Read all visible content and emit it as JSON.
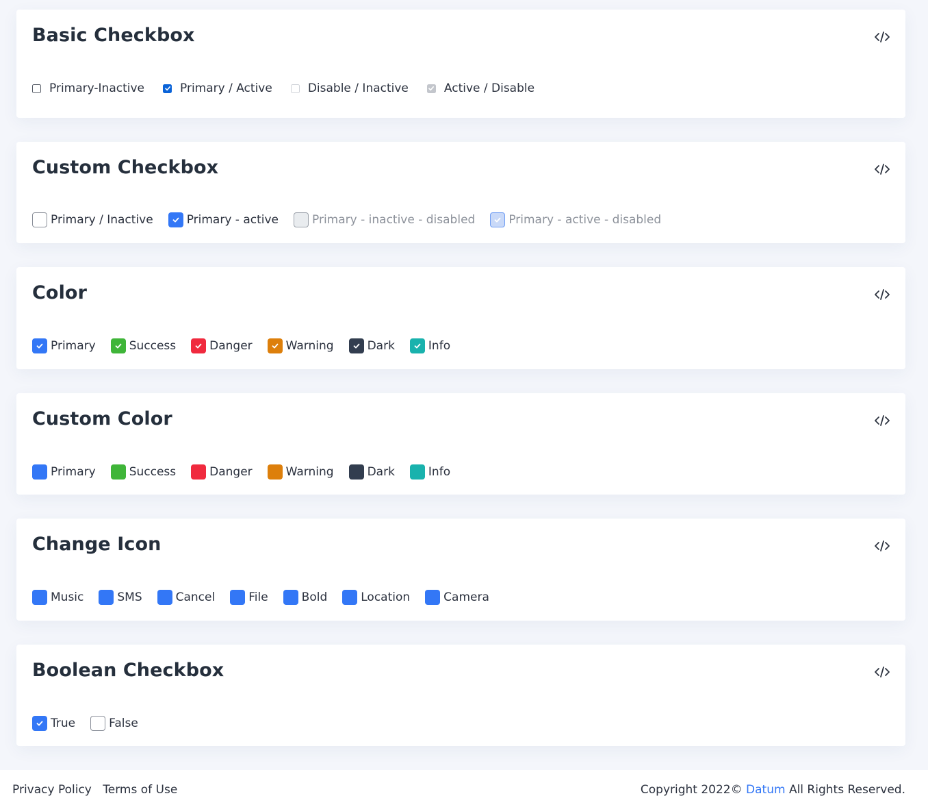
{
  "sections": {
    "basic": {
      "title": "Basic Checkbox",
      "items": [
        {
          "label": "Primary-Inactive"
        },
        {
          "label": "Primary / Active"
        },
        {
          "label": "Disable / Inactive"
        },
        {
          "label": "Active / Disable"
        }
      ]
    },
    "custom": {
      "title": "Custom Checkbox",
      "items": [
        {
          "label": "Primary / Inactive"
        },
        {
          "label": "Primary - active"
        },
        {
          "label": "Primary - inactive - disabled"
        },
        {
          "label": "Primary - active - disabled"
        }
      ]
    },
    "color": {
      "title": "Color",
      "items": [
        {
          "label": "Primary"
        },
        {
          "label": "Success"
        },
        {
          "label": "Danger"
        },
        {
          "label": "Warning"
        },
        {
          "label": "Dark"
        },
        {
          "label": "Info"
        }
      ]
    },
    "custom_color": {
      "title": "Custom Color",
      "items": [
        {
          "label": "Primary"
        },
        {
          "label": "Success"
        },
        {
          "label": "Danger"
        },
        {
          "label": "Warning"
        },
        {
          "label": "Dark"
        },
        {
          "label": "Info"
        }
      ]
    },
    "change_icon": {
      "title": "Change Icon",
      "items": [
        {
          "label": "Music"
        },
        {
          "label": "SMS"
        },
        {
          "label": "Cancel"
        },
        {
          "label": "File"
        },
        {
          "label": "Bold"
        },
        {
          "label": "Location"
        },
        {
          "label": "Camera"
        }
      ]
    },
    "boolean": {
      "title": "Boolean Checkbox",
      "items": [
        {
          "label": "True"
        },
        {
          "label": "False"
        }
      ]
    }
  },
  "footer": {
    "privacy": "Privacy Policy",
    "terms": "Terms of Use",
    "copyright_prefix": "Copyright 2022©",
    "brand": "Datum",
    "copyright_suffix": "All Rights Reserved."
  },
  "colors": {
    "primary": "#3377f6",
    "success": "#3fb539",
    "danger": "#f02a3e",
    "warning": "#dd7f0b",
    "dark": "#323d4f",
    "info": "#19b2ad",
    "native_checked": "#0a63d8",
    "disabled_bg": "#e9ecef"
  },
  "icons": {
    "code": "code-icon",
    "check": "check-icon"
  }
}
